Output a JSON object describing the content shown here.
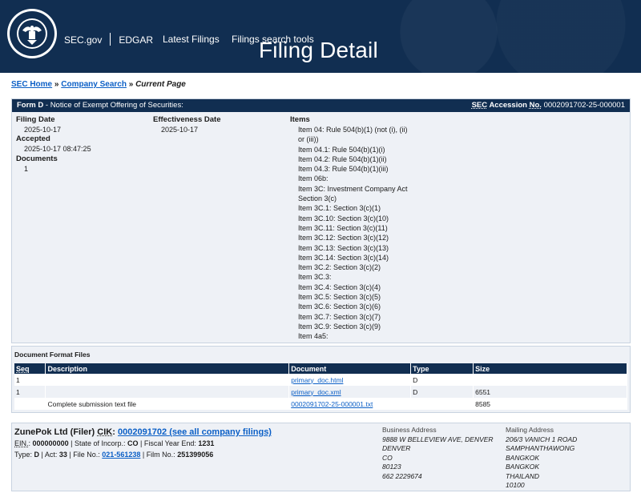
{
  "header": {
    "agency_link": "SEC.gov",
    "system_link": "EDGAR",
    "nav": [
      "Latest Filings",
      "Filings search tools"
    ],
    "page_title": "Filing Detail"
  },
  "breadcrumb": {
    "home": "SEC Home",
    "sep1": "»",
    "search": "Company Search",
    "sep2": "»",
    "current": "Current Page"
  },
  "form": {
    "form_type": "Form D",
    "description": " - Notice of Exempt Offering of Securities:",
    "accession_label_1": "SEC",
    "accession_label_2": "Accession",
    "accession_label_3": "No.",
    "accession_number": "0002091702-25-000001",
    "filing_date_label": "Filing Date",
    "filing_date": "2025-10-17",
    "accepted_label": "Accepted",
    "accepted": "2025-10-17 08:47:25",
    "documents_label": "Documents",
    "documents": "1",
    "effectiveness_label": "Effectiveness Date",
    "effectiveness_date": "2025-10-17",
    "items_label": "Items",
    "items": [
      "Item 04: Rule 504(b)(1) (not (i), (ii) or (iii))",
      "Item 04.1: Rule 504(b)(1)(i)",
      "Item 04.2: Rule 504(b)(1)(ii)",
      "Item 04.3: Rule 504(b)(1)(iii)",
      "Item 06b:",
      "Item 3C: Investment Company Act Section 3(c)",
      "Item 3C.1: Section 3(c)(1)",
      "Item 3C.10: Section 3(c)(10)",
      "Item 3C.11: Section 3(c)(11)",
      "Item 3C.12: Section 3(c)(12)",
      "Item 3C.13: Section 3(c)(13)",
      "Item 3C.14: Section 3(c)(14)",
      "Item 3C.2: Section 3(c)(2)",
      "Item 3C.3:",
      "Item 3C.4: Section 3(c)(4)",
      "Item 3C.5: Section 3(c)(5)",
      "Item 3C.6: Section 3(c)(6)",
      "Item 3C.7: Section 3(c)(7)",
      "Item 3C.9: Section 3(c)(9)",
      "Item 4a5:"
    ]
  },
  "documents": {
    "heading": "Document Format Files",
    "columns": [
      "Seq",
      "Description",
      "Document",
      "Type",
      "Size"
    ],
    "rows": [
      {
        "seq": "1",
        "description": "",
        "document": "primary_doc.html",
        "type": "D",
        "size": ""
      },
      {
        "seq": "1",
        "description": "",
        "document": "primary_doc.xml",
        "type": "D",
        "size": "6551"
      },
      {
        "seq": "",
        "description": "Complete submission text file",
        "document": "0002091702-25-000001.txt",
        "type": "",
        "size": "8585"
      }
    ]
  },
  "filer": {
    "name": "ZunePok Ltd (Filer)",
    "cik_label": "CIK",
    "cik_link": "0002091702 (see all company filings)",
    "ein_label": "EIN.",
    "ein": "000000000",
    "state_label": "State of Incorp.:",
    "state": "CO",
    "fye_label": "Fiscal Year End:",
    "fye": "1231",
    "type_label": "Type:",
    "type": "D",
    "act_label": "Act:",
    "act": "33",
    "file_no_label": "File No.:",
    "file_no": "021-561238",
    "film_no_label": "Film No.:",
    "film_no": "251399056",
    "business_address_label": "Business Address",
    "business_address": [
      "9888 W BELLEVIEW AVE, DENVER",
      "DENVER",
      "CO",
      "80123",
      "662 2229674"
    ],
    "mailing_address_label": "Mailing Address",
    "mailing_address": [
      "206/3 VANICH 1 ROAD",
      "SAMPHANTHAWONG",
      "BANGKOK",
      "BANGKOK",
      "THAILAND",
      "10100"
    ]
  },
  "seal_text": "U.S. SECURITIES AND EXCHANGE COMMISSION MCMXXXIV"
}
